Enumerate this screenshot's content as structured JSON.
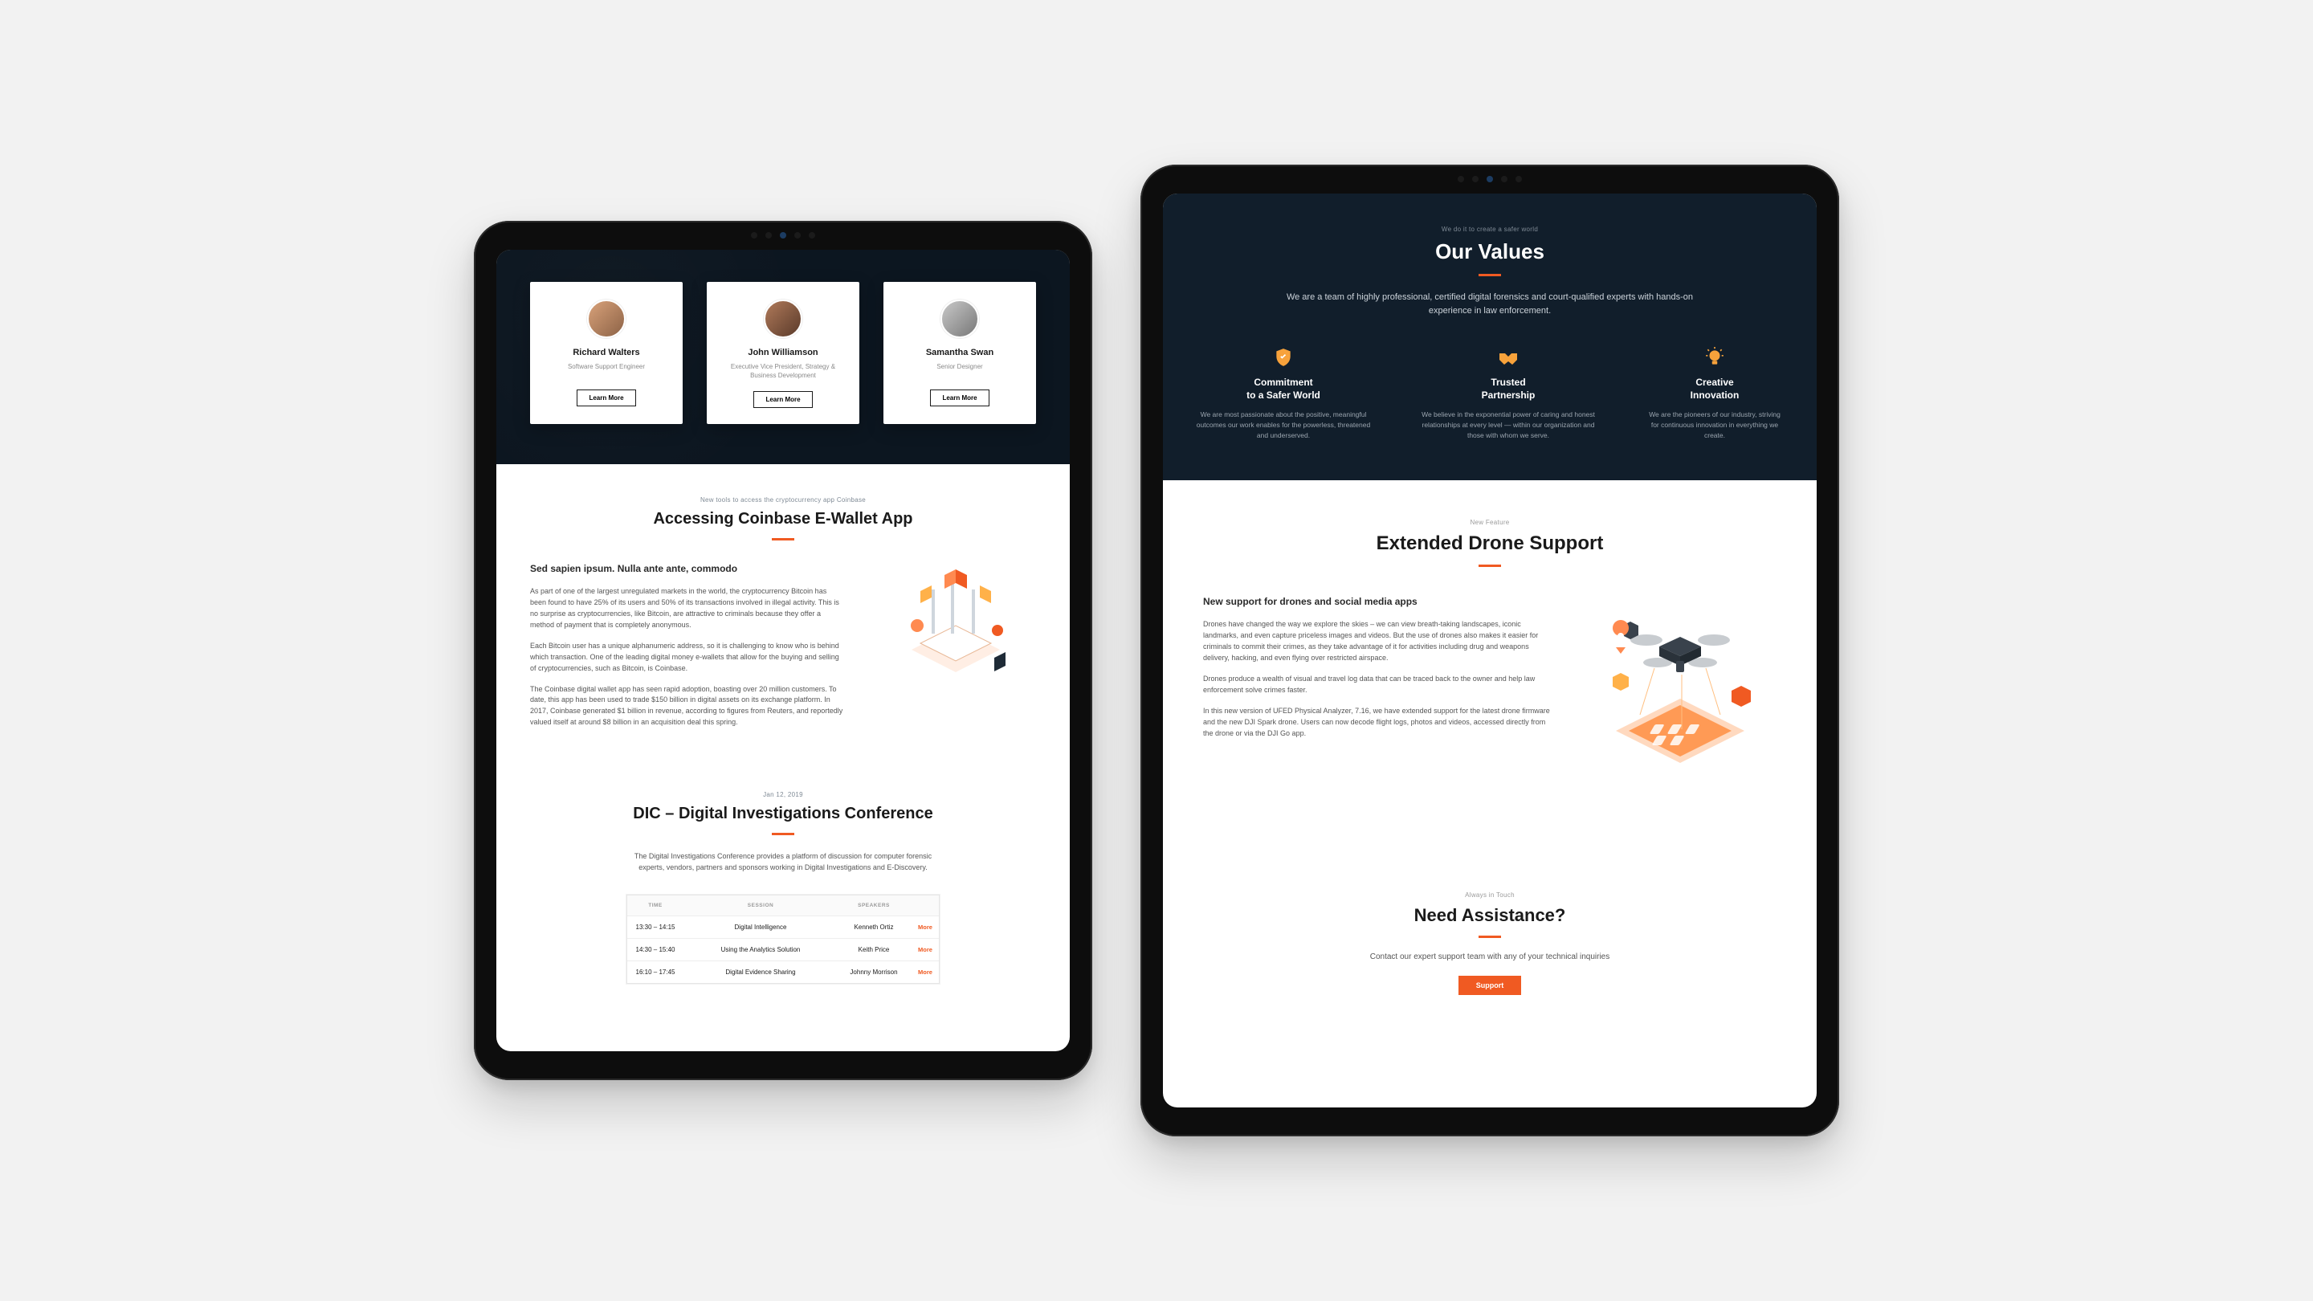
{
  "accent": "#f05a22",
  "tablet_large": {
    "values_section": {
      "eyebrow": "We do it to create a safer world",
      "title": "Our Values",
      "lead": "We are a team of highly professional, certified digital forensics and court-qualified experts with hands-on experience in law enforcement.",
      "items": [
        {
          "icon": "shield-check-icon",
          "title_line1": "Commitment",
          "title_line2": "to a Safer World",
          "desc": "We are most passionate about the positive, meaningful outcomes our work enables for the powerless, threatened and underserved."
        },
        {
          "icon": "handshake-icon",
          "title_line1": "Trusted",
          "title_line2": "Partnership",
          "desc": "We believe in the exponential power of caring and honest relationships at every level — within our organization and those with whom we serve."
        },
        {
          "icon": "lightbulb-icon",
          "title_line1": "Creative",
          "title_line2": "Innovation",
          "desc": "We are the pioneers of our industry, striving for continuous innovation in everything we create."
        }
      ]
    },
    "feature_section": {
      "eyebrow": "New Feature",
      "title": "Extended Drone Support",
      "subhead": "New support for drones and social media apps",
      "paragraphs": [
        "Drones have changed the way we explore the skies – we can view breath-taking landscapes, iconic landmarks, and even capture priceless images and videos. But the use of drones also makes it easier for criminals to commit their crimes, as they take advantage of it for activities including drug and weapons delivery, hacking, and even flying over restricted airspace.",
        "Drones produce a wealth of visual and travel log data that can be traced back to the owner and help law enforcement solve crimes faster.",
        "In this new version of UFED Physical Analyzer, 7.16, we have extended support for the latest drone firmware and the new DJI Spark drone. Users can now decode flight logs, photos and videos, accessed directly from the drone or via the DJI Go app."
      ]
    },
    "assistance_section": {
      "eyebrow": "Always in Touch",
      "title": "Need Assistance?",
      "lead": "Contact our expert support team with any of your technical inquiries",
      "button": "Support"
    }
  },
  "tablet_small": {
    "team": {
      "learn_more": "Learn More",
      "members": [
        {
          "name": "Richard Walters",
          "role": "Software Support Engineer"
        },
        {
          "name": "John Williamson",
          "role": "Executive Vice President, Strategy & Business Development"
        },
        {
          "name": "Samantha Swan",
          "role": "Senior Designer"
        }
      ]
    },
    "coinbase_section": {
      "eyebrow": "New tools to access the cryptocurrency app Coinbase",
      "title": "Accessing Coinbase E-Wallet App",
      "subhead": "Sed sapien ipsum. Nulla ante ante, commodo",
      "paragraphs": [
        "As part of one of the largest unregulated markets in the world, the cryptocurrency Bitcoin has been found to have 25% of its users and 50% of its transactions involved in illegal activity. This is no surprise as cryptocurrencies, like Bitcoin, are attractive to criminals because they offer a method of payment that is completely anonymous.",
        "Each Bitcoin user has a unique alphanumeric address, so it is challenging to know who is behind which transaction. One of the leading digital money e-wallets that allow for the buying and selling of cryptocurrencies, such as Bitcoin, is Coinbase.",
        "The Coinbase digital wallet app has seen rapid adoption, boasting over 20 million customers. To date, this app has been used to trade $150 billion in digital assets on its exchange platform. In 2017, Coinbase generated $1 billion in revenue, according to figures from Reuters, and reportedly valued itself at around $8 billion in an acquisition deal this spring."
      ]
    },
    "conference_section": {
      "eyebrow": "Jan 12, 2019",
      "title": "DIC – Digital Investigations Conference",
      "lead": "The Digital Investigations Conference provides a platform of discussion for computer forensic experts, vendors, partners and sponsors working in Digital Investigations and E-Discovery.",
      "table": {
        "headers": {
          "time": "TIME",
          "session": "SESSION",
          "speakers": "SPEAKERS"
        },
        "more_label": "More",
        "rows": [
          {
            "time": "13:30 – 14:15",
            "session": "Digital Intelligence",
            "speaker": "Kenneth Ortiz"
          },
          {
            "time": "14:30 – 15:40",
            "session": "Using the Analytics Solution",
            "speaker": "Keith Price"
          },
          {
            "time": "16:10 – 17:45",
            "session": "Digital Evidence Sharing",
            "speaker": "Johnny Morrison"
          }
        ]
      }
    }
  }
}
